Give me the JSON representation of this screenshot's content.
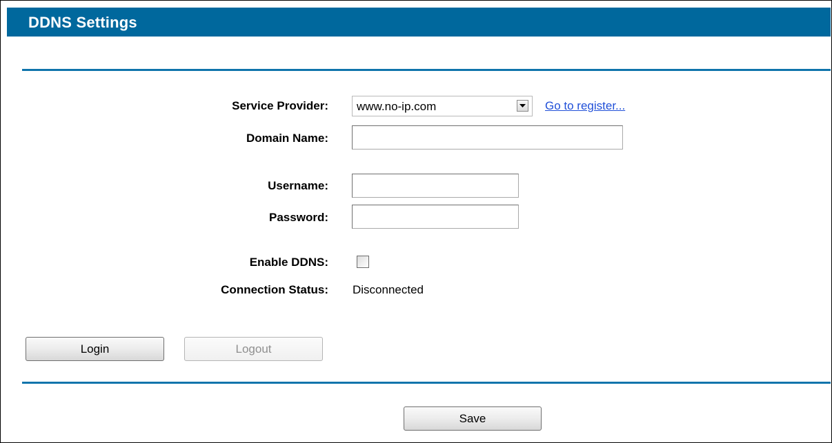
{
  "header": {
    "title": "DDNS Settings"
  },
  "form": {
    "service_provider": {
      "label": "Service Provider:",
      "selected": "www.no-ip.com",
      "register_link": "Go to register..."
    },
    "domain_name": {
      "label": "Domain Name:",
      "value": ""
    },
    "username": {
      "label": "Username:",
      "value": ""
    },
    "password": {
      "label": "Password:",
      "value": ""
    },
    "enable_ddns": {
      "label": "Enable DDNS:",
      "checked": false
    },
    "connection_status": {
      "label": "Connection Status:",
      "value": "Disconnected"
    }
  },
  "buttons": {
    "login": "Login",
    "logout": "Logout",
    "save": "Save"
  },
  "colors": {
    "header_bg": "#00689d",
    "divider": "#0e74ac",
    "link": "#1f4fd8"
  }
}
